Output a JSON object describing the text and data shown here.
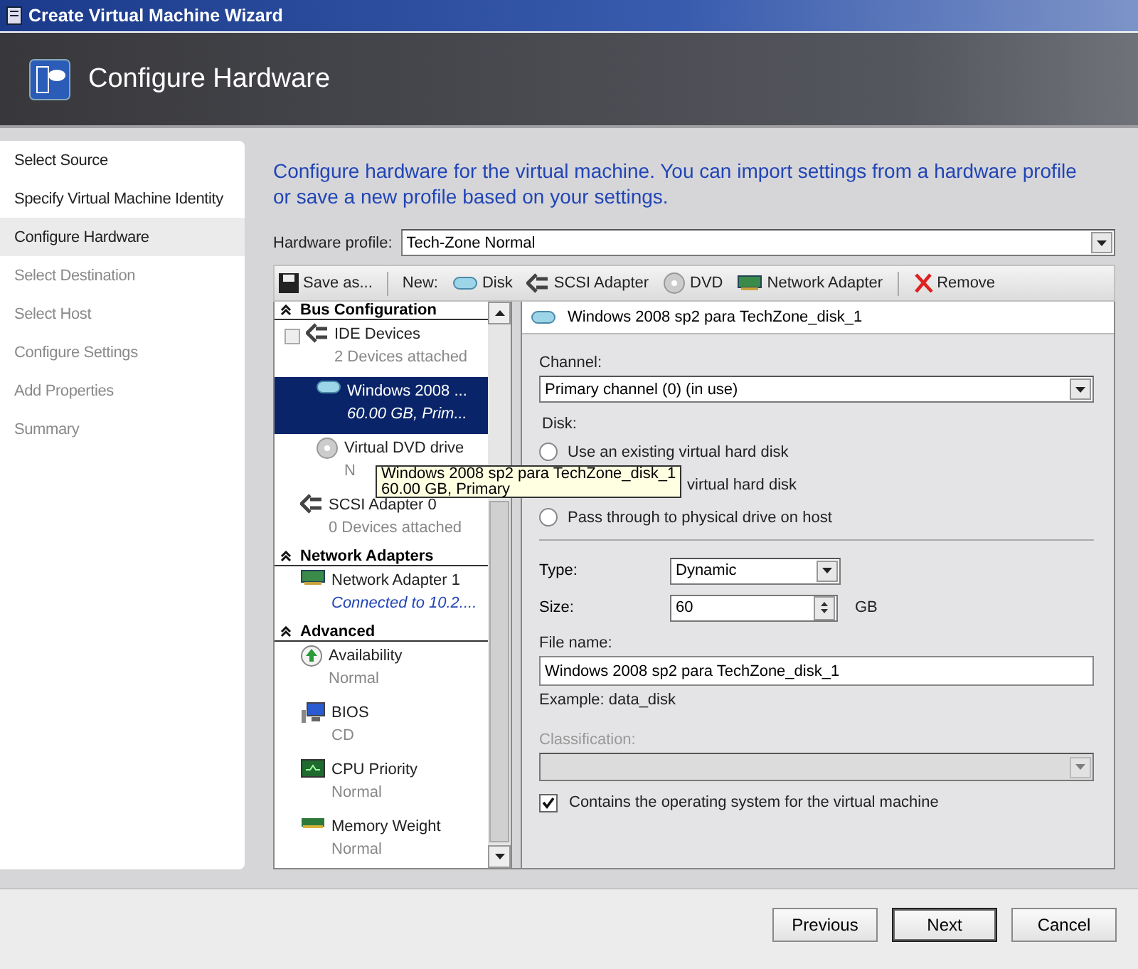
{
  "window": {
    "title": "Create Virtual Machine Wizard"
  },
  "header": {
    "title": "Configure Hardware"
  },
  "steps": [
    {
      "label": "Select Source",
      "selected": false,
      "disabled": false
    },
    {
      "label": "Specify Virtual Machine Identity",
      "selected": false,
      "disabled": false
    },
    {
      "label": "Configure Hardware",
      "selected": true,
      "disabled": false
    },
    {
      "label": "Select Destination",
      "selected": false,
      "disabled": true
    },
    {
      "label": "Select Host",
      "selected": false,
      "disabled": true
    },
    {
      "label": "Configure Settings",
      "selected": false,
      "disabled": true
    },
    {
      "label": "Add Properties",
      "selected": false,
      "disabled": true
    },
    {
      "label": "Summary",
      "selected": false,
      "disabled": true
    }
  ],
  "intro": "Configure hardware for the virtual machine. You can import settings from a hardware profile or save a new profile based on your settings.",
  "hardware_profile": {
    "label": "Hardware profile:",
    "value": "Tech-Zone Normal"
  },
  "toolbar": [
    {
      "kind": "save",
      "label": "Save as..."
    },
    {
      "kind": "separator"
    },
    {
      "kind": "text",
      "label": "New:"
    },
    {
      "kind": "disk",
      "label": "Disk"
    },
    {
      "kind": "scsi",
      "label": "SCSI Adapter"
    },
    {
      "kind": "dvd",
      "label": "DVD"
    },
    {
      "kind": "nic",
      "label": "Network Adapter"
    },
    {
      "kind": "separator"
    },
    {
      "kind": "remove",
      "label": "Remove"
    }
  ],
  "tree": [
    {
      "title": "Bus Configuration",
      "items": [
        {
          "kind": "controller",
          "name": "IDE Devices",
          "sub": "2 Devices attached",
          "selected": false,
          "expanded": true,
          "children": [
            {
              "kind": "disk",
              "name": "Windows 2008 ...",
              "sub": "60.00 GB, Prim...",
              "selected": true
            },
            {
              "kind": "dvd",
              "name": "Virtual DVD drive",
              "sub": "N",
              "selected": false
            }
          ]
        },
        {
          "kind": "controller",
          "name": "SCSI Adapter 0",
          "sub": "0 Devices attached",
          "selected": false
        }
      ]
    },
    {
      "title": "Network Adapters",
      "items": [
        {
          "kind": "nic",
          "name": "Network Adapter 1",
          "sub": "Connected to 10.2....",
          "selected": false
        }
      ]
    },
    {
      "title": "Advanced",
      "items": [
        {
          "kind": "availability",
          "name": "Availability",
          "sub": "Normal",
          "selected": false
        },
        {
          "kind": "bios",
          "name": "BIOS",
          "sub": "CD",
          "selected": false
        },
        {
          "kind": "cpu",
          "name": "CPU Priority",
          "sub": "Normal",
          "selected": false
        },
        {
          "kind": "memory",
          "name": "Memory Weight",
          "sub": "Normal",
          "selected": false
        }
      ]
    }
  ],
  "tooltip": {
    "lines": [
      "Windows 2008 sp2 para TechZone_disk_1",
      "60.00 GB, Primary"
    ]
  },
  "details": {
    "title": "Windows 2008 sp2 para TechZone_disk_1",
    "channel": {
      "label": "Channel:",
      "value": "Primary channel (0) (in use)"
    },
    "disk_label": "Disk:",
    "disk_options": [
      {
        "kind": "radio",
        "label": "Use an existing virtual hard disk",
        "selected": false
      },
      {
        "kind": "covered",
        "label": "virtual hard disk"
      },
      {
        "kind": "radio",
        "label": "Pass through to physical drive on host",
        "selected": false
      }
    ],
    "type": {
      "label": "Type:",
      "value": "Dynamic"
    },
    "size": {
      "label": "Size:",
      "value": "60",
      "unit": "GB"
    },
    "file_name": {
      "label": "File name:",
      "value": "Windows 2008 sp2 para TechZone_disk_1",
      "example": "Example: data_disk"
    },
    "classification": {
      "label": "Classification:",
      "disabled": true
    },
    "contains_os": {
      "label": "Contains the operating system for the virtual machine",
      "checked": true
    }
  },
  "buttons": [
    {
      "label": "Previous",
      "default": false
    },
    {
      "label": "Next",
      "default": true
    },
    {
      "label": "Cancel",
      "default": false
    }
  ]
}
